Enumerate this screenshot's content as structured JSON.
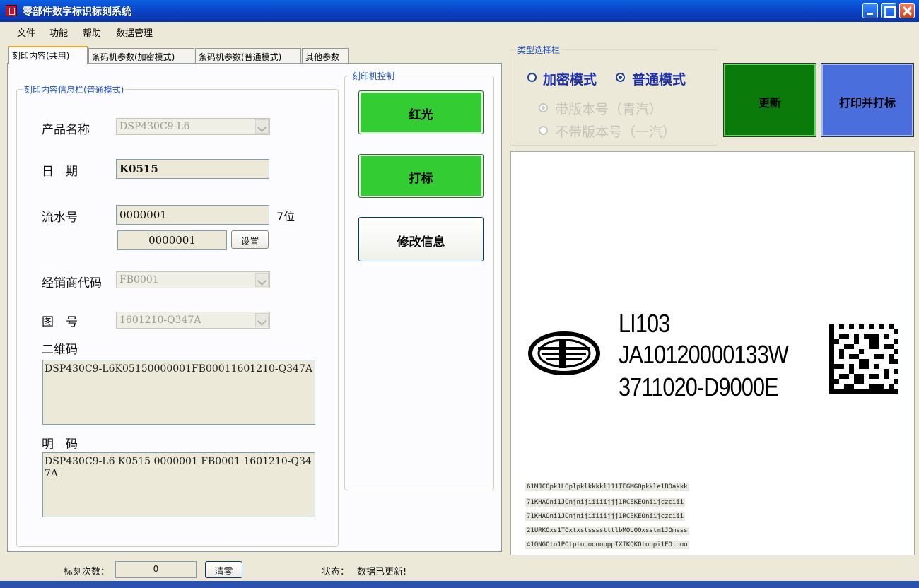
{
  "window": {
    "title": "零部件数字标识标刻系统"
  },
  "menu": [
    "文件",
    "功能",
    "帮助",
    "数据管理"
  ],
  "tabs": [
    "刻印内容(共用)",
    "条码机参数(加密模式)",
    "条码机参数(普通模式)",
    "其他参数"
  ],
  "info_group": {
    "legend": "刻印内容信息栏(普通模式)",
    "product_name_label": "产品名称",
    "product_name_value": "DSP430C9-L6",
    "date_label": "日　期",
    "date_value": "K0515",
    "serial_label": "流水号",
    "serial_value": "0000001",
    "serial_digits": "7位",
    "serial_sub_value": "0000001",
    "set_button": "设置",
    "dealer_label": "经销商代码",
    "dealer_value": "FB0001",
    "drawing_label": "图　号",
    "drawing_value": "1601210-Q347A",
    "qr_label": "二维码",
    "qr_value": "DSP430C9-L6K05150000001FB00011601210-Q347A",
    "plain_label": "明　码",
    "plain_value": "DSP430C9-L6 K0515 0000001 FB0001 1601210-Q347A"
  },
  "printer_group": {
    "legend": "刻印机控制",
    "red_light": "红光",
    "mark": "打标",
    "modify": "修改信息"
  },
  "type_group": {
    "legend": "类型选择栏",
    "encrypted_mode": "加密模式",
    "normal_mode": "普通模式",
    "with_version": "带版本号（青汽）",
    "without_version": "不带版本号（一汽）"
  },
  "actions": {
    "update": "更新",
    "print_and_mark": "打印并打标"
  },
  "preview": {
    "line1": "LI103",
    "line2": "JA10120000133W",
    "line3": "3711020-D9000E",
    "codes": [
      "61MJCOpk1LOplpklkkkkl111TEGMGOpkkle1BOakkk",
      "71KHAOni1JOnjnijiiiiijjj1RCEKEOniijczciii",
      "71KHAOni1JOnjnijiiiiijjj1RCEKEOniijczciii",
      "21URKOxs1TOxtxstsssstttlbMOUOOxsstm1JOmsss",
      "41QNGOto1POtptopoooopppIXIKQKOtoopi1FOiooo"
    ]
  },
  "status_bar": {
    "mark_count_label": "标刻次数：",
    "mark_count_value": "0",
    "clear_button": "清零",
    "status_label": "状态：",
    "status_value": "数据已更新!"
  },
  "colors": {
    "green_button": "#33cc33",
    "update_button": "#0a7a0a",
    "print_button": "#4a6fdc",
    "titlebar": "#0a4fd0"
  }
}
